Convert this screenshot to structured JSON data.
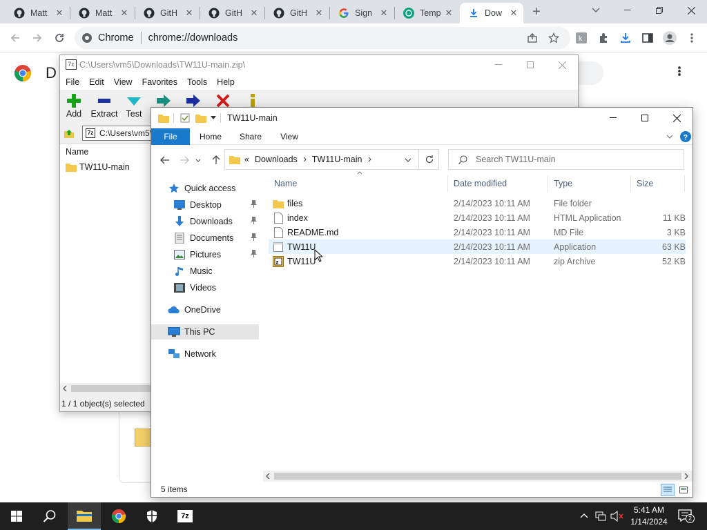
{
  "chrome": {
    "tabs": [
      {
        "title": "Matt",
        "icon": "github-icon"
      },
      {
        "title": "Matt",
        "icon": "github-icon"
      },
      {
        "title": "GitH",
        "icon": "github-icon"
      },
      {
        "title": "GitH",
        "icon": "github-icon"
      },
      {
        "title": "GitH",
        "icon": "github-icon"
      },
      {
        "title": "Sign",
        "icon": "google-icon"
      },
      {
        "title": "Temp",
        "icon": "openai-icon"
      },
      {
        "title": "Dow",
        "icon": "download-icon",
        "active": true
      }
    ],
    "omnibox": {
      "site_label": "Chrome",
      "url": "chrome://downloads"
    },
    "page_title_fragment": "D"
  },
  "zip": {
    "title": "C:\\Users\\vm5\\Downloads\\TW11U-main.zip\\",
    "menu": [
      "File",
      "Edit",
      "View",
      "Favorites",
      "Tools",
      "Help"
    ],
    "tools": [
      {
        "label": "Add",
        "icon": "plus-icon",
        "color": "#19a319"
      },
      {
        "label": "Extract",
        "icon": "minus-icon",
        "color": "#1b2fa3"
      },
      {
        "label": "Test",
        "icon": "check-icon",
        "color": "#1fb8c8"
      }
    ],
    "address": "C:\\Users\\vm5\\",
    "column_name": "Name",
    "items": [
      "TW11U-main"
    ],
    "status": "1 / 1 object(s) selected"
  },
  "explorer": {
    "title": "TW11U-main",
    "ribbon_tabs": [
      "File",
      "Home",
      "Share",
      "View"
    ],
    "address": {
      "overflow": "«",
      "crumbs": [
        "Downloads",
        "TW11U-main"
      ]
    },
    "search_placeholder": "Search TW11U-main",
    "nav": [
      {
        "label": "Quick access",
        "icon": "star-icon",
        "indent": 0,
        "top": 0
      },
      {
        "label": "Desktop",
        "icon": "desktop-icon",
        "indent": 1,
        "pinned": true
      },
      {
        "label": "Downloads",
        "icon": "download-arrow-icon",
        "indent": 1,
        "pinned": true
      },
      {
        "label": "Documents",
        "icon": "document-icon",
        "indent": 1,
        "pinned": true
      },
      {
        "label": "Pictures",
        "icon": "picture-icon",
        "indent": 1,
        "pinned": true
      },
      {
        "label": "Music",
        "icon": "music-icon",
        "indent": 1
      },
      {
        "label": "Videos",
        "icon": "video-icon",
        "indent": 1
      },
      {
        "label": "OneDrive",
        "icon": "cloud-icon",
        "indent": 0
      },
      {
        "label": "This PC",
        "icon": "computer-icon",
        "indent": 0,
        "selected": true
      },
      {
        "label": "Network",
        "icon": "network-icon",
        "indent": 0
      }
    ],
    "columns": [
      "Name",
      "Date modified",
      "Type",
      "Size"
    ],
    "files": [
      {
        "name": "files",
        "date": "2/14/2023 10:11 AM",
        "type": "File folder",
        "size": "",
        "icon": "folder-icon"
      },
      {
        "name": "index",
        "date": "2/14/2023 10:11 AM",
        "type": "HTML Application",
        "size": "11 KB",
        "icon": "file-icon"
      },
      {
        "name": "README.md",
        "date": "2/14/2023 10:11 AM",
        "type": "MD File",
        "size": "3 KB",
        "icon": "file-icon"
      },
      {
        "name": "TW11U",
        "date": "2/14/2023 10:11 AM",
        "type": "Application",
        "size": "63 KB",
        "icon": "app-icon",
        "hover": true
      },
      {
        "name": "TW11U",
        "date": "2/14/2023 10:11 AM",
        "type": "zip Archive",
        "size": "52 KB",
        "icon": "zip-icon"
      }
    ],
    "status": "5 items"
  },
  "taskbar": {
    "time": "5:41 AM",
    "date": "1/14/2024",
    "notification_count": "2"
  }
}
